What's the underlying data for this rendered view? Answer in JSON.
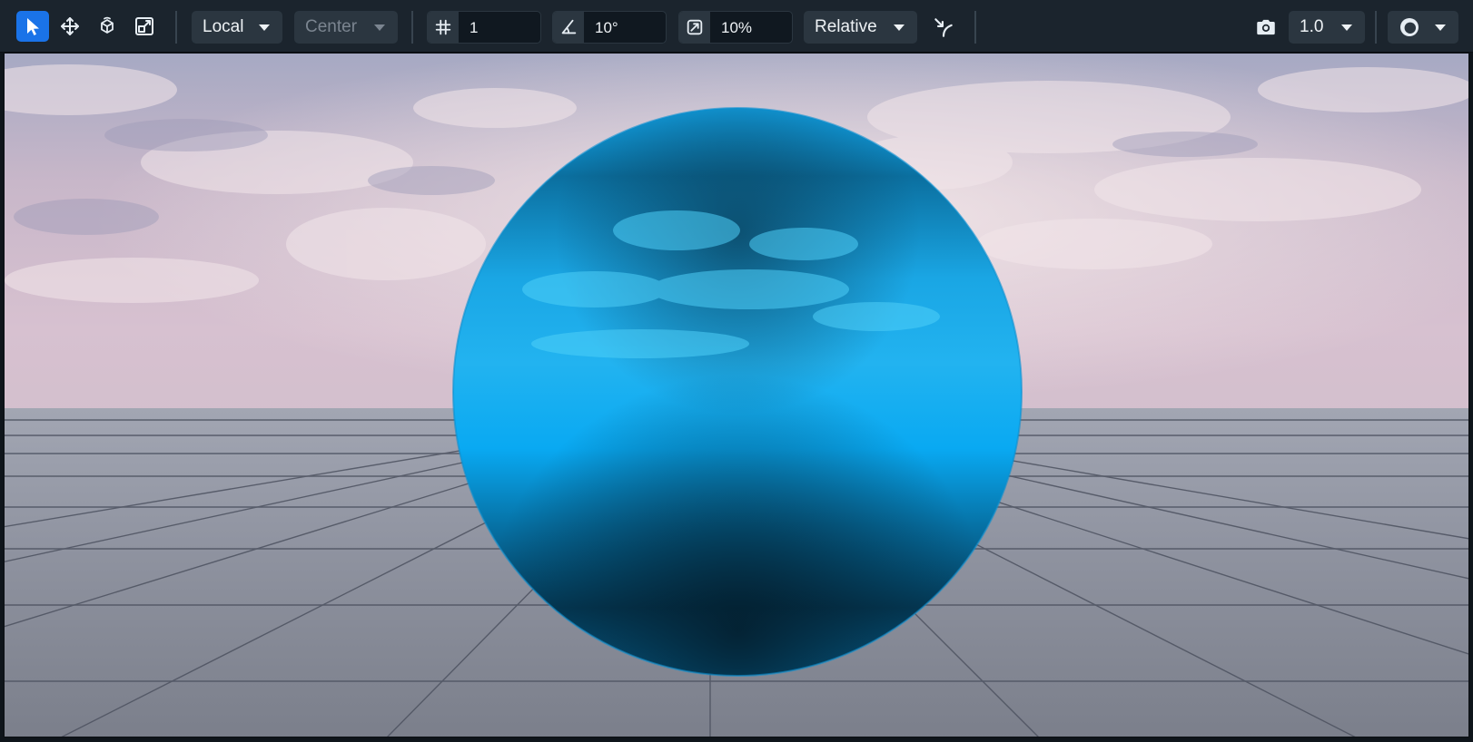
{
  "toolbar": {
    "tools": [
      {
        "name": "select-tool",
        "icon": "cursor-icon",
        "active": true
      },
      {
        "name": "move-tool",
        "icon": "move-arrows-icon",
        "active": false
      },
      {
        "name": "rotate-tool",
        "icon": "rotate-cube-icon",
        "active": false
      },
      {
        "name": "scale-tool",
        "icon": "scale-box-icon",
        "active": false
      }
    ],
    "space_label": "Local",
    "pivot_label": "Center",
    "grid_icon": "grid-hash-icon",
    "grid_value": "1",
    "angle_icon": "angle-icon",
    "angle_value": "10°",
    "scale_icon": "scale-snap-icon",
    "scale_value": "10%",
    "snap_mode_label": "Relative",
    "surface_snap_icon": "surface-snap-icon",
    "camera_icon": "camera-icon",
    "camera_speed": "1.0",
    "render_mode_icon": "shading-sphere-icon"
  },
  "colors": {
    "active_tool": "#1a73e8",
    "toolbar_bg": "#1b242d",
    "control_bg": "#2b3640",
    "sphere": "#08aaf2"
  }
}
